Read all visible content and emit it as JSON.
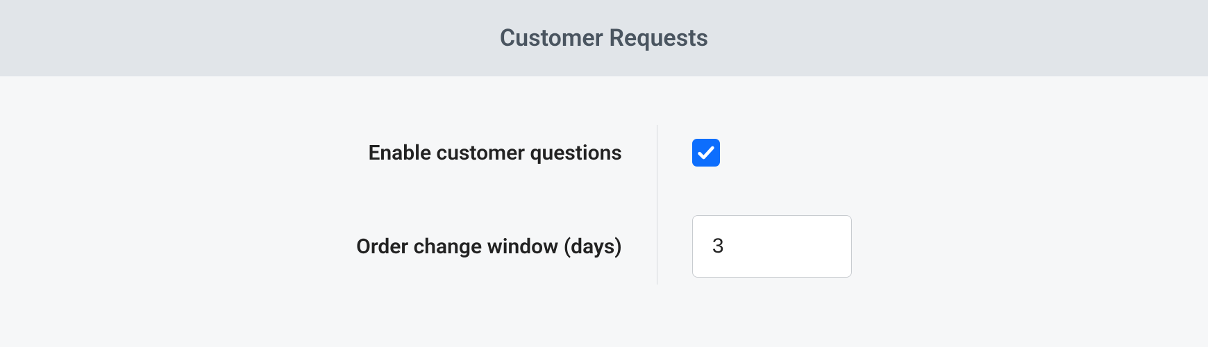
{
  "header": {
    "title": "Customer Requests"
  },
  "fields": {
    "enable_questions": {
      "label": "Enable customer questions",
      "checked": true
    },
    "order_change_window": {
      "label": "Order change window (days)",
      "value": "3"
    }
  }
}
